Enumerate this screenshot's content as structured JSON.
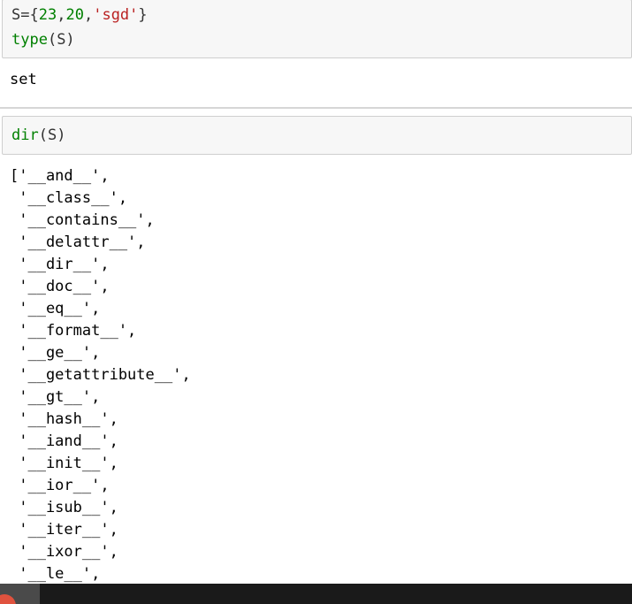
{
  "cells": [
    {
      "id": "cell-1",
      "code_lines": [
        {
          "parts": [
            {
              "t": "S",
              "c": "op"
            },
            {
              "t": "=",
              "c": "op"
            },
            {
              "t": "{",
              "c": "op"
            },
            {
              "t": "23",
              "c": "num"
            },
            {
              "t": ",",
              "c": "op"
            },
            {
              "t": "20",
              "c": "num"
            },
            {
              "t": ",",
              "c": "op"
            },
            {
              "t": "'sgd'",
              "c": "str"
            },
            {
              "t": "}",
              "c": "op"
            }
          ]
        },
        {
          "parts": [
            {
              "t": "type",
              "c": "kw"
            },
            {
              "t": "(S)",
              "c": "op"
            }
          ]
        }
      ],
      "output": [
        "set"
      ]
    },
    {
      "id": "cell-2",
      "code_lines": [
        {
          "parts": [
            {
              "t": "dir",
              "c": "kw"
            },
            {
              "t": "(S)",
              "c": "op"
            }
          ]
        }
      ],
      "output": [
        "['__and__',",
        " '__class__',",
        " '__contains__',",
        " '__delattr__',",
        " '__dir__',",
        " '__doc__',",
        " '__eq__',",
        " '__format__',",
        " '__ge__',",
        " '__getattribute__',",
        " '__gt__',",
        " '__hash__',",
        " '__iand__',",
        " '__init__',",
        " '__ior__',",
        " '__isub__',",
        " '__iter__',",
        " '__ixor__',",
        " '__le__',"
      ]
    }
  ],
  "colors": {
    "keyword": "#008000",
    "number": "#008000",
    "string": "#ba2121",
    "cell_background": "#f7f7f7",
    "cell_border": "#cfcfcf"
  }
}
